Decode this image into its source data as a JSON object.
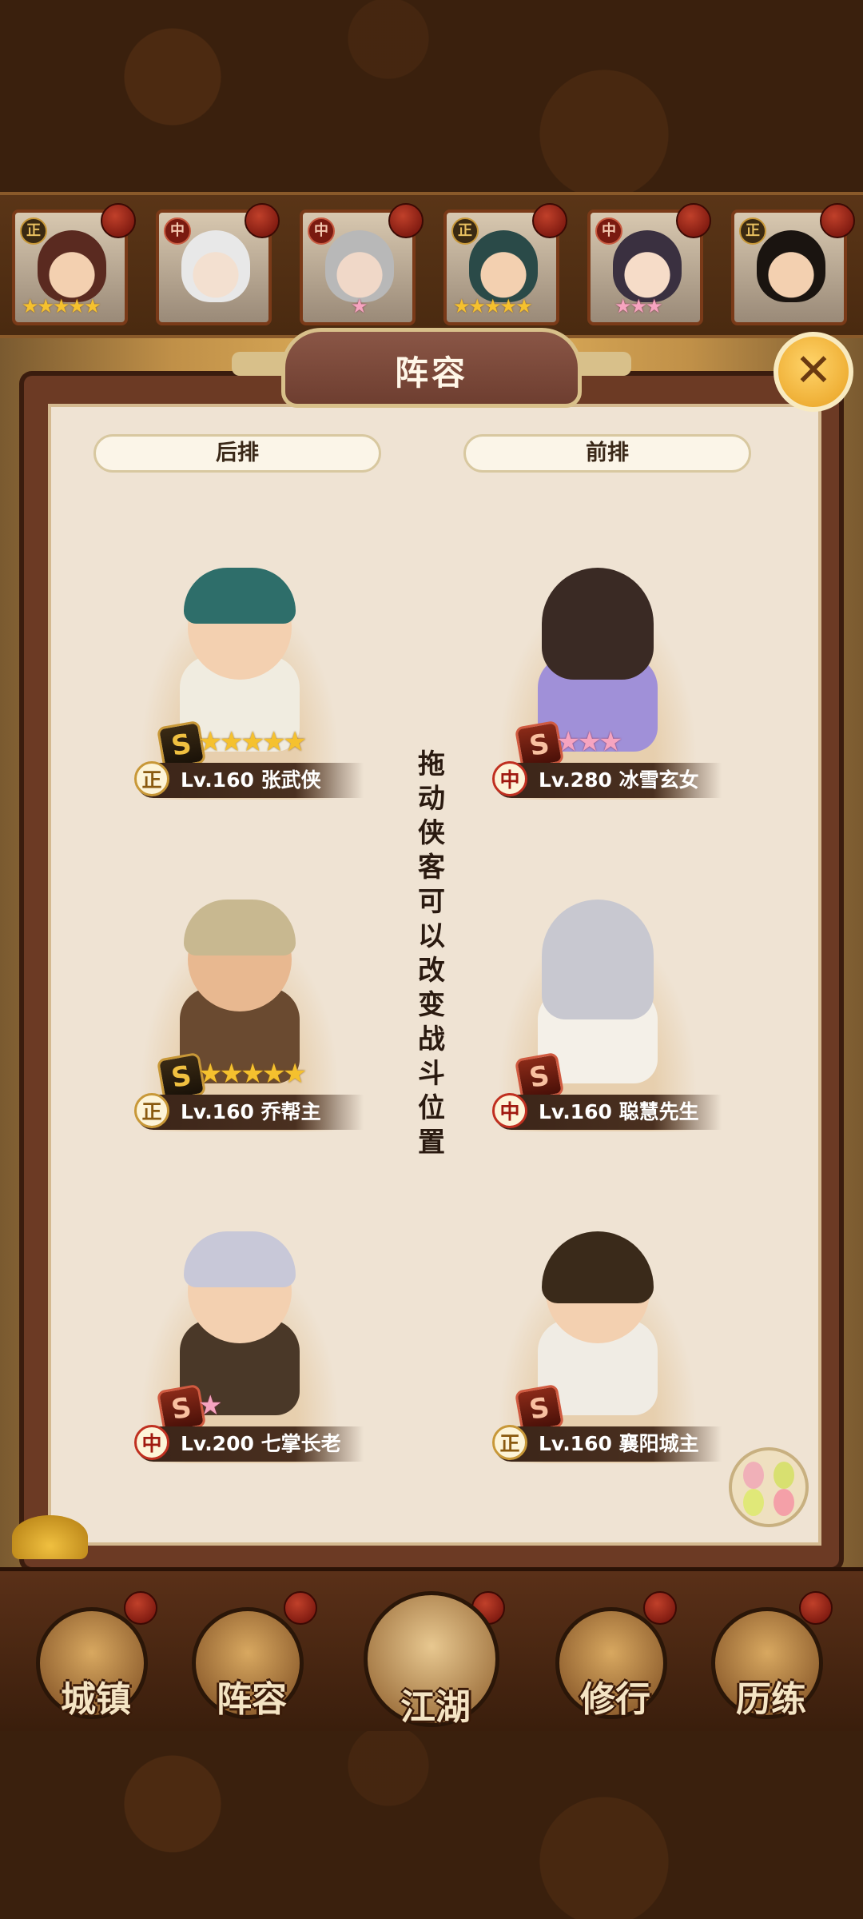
{
  "panel": {
    "title": "阵容",
    "close_icon": "✕"
  },
  "rows": {
    "back": "后排",
    "front": "前排"
  },
  "hint": "拖动侠客可以改变战斗位置",
  "hero_strip": [
    {
      "badge": "正",
      "badge_type": "zheng",
      "stars": "★★★★★",
      "star_color": "gold"
    },
    {
      "badge": "中",
      "badge_type": "zhong",
      "stars": "",
      "star_color": "gold"
    },
    {
      "badge": "中",
      "badge_type": "zhong",
      "stars": "★",
      "star_color": "pink"
    },
    {
      "badge": "正",
      "badge_type": "zheng",
      "stars": "★★★★★",
      "star_color": "gold"
    },
    {
      "badge": "中",
      "badge_type": "zhong",
      "stars": "★★★",
      "star_color": "pink"
    },
    {
      "badge": "正",
      "badge_type": "zheng",
      "stars": "",
      "star_color": "gold"
    }
  ],
  "lineup": [
    {
      "class": "正",
      "level": "Lv.160",
      "name": "张武侠",
      "rank": "S",
      "stars": "★★★★★",
      "star_color": "gold"
    },
    {
      "class": "中",
      "level": "Lv.280",
      "name": "冰雪玄女",
      "rank": "S",
      "stars": "★★★",
      "star_color": "pink"
    },
    {
      "class": "正",
      "level": "Lv.160",
      "name": "乔帮主",
      "rank": "S",
      "stars": "★★★★★",
      "star_color": "gold"
    },
    {
      "class": "中",
      "level": "Lv.160",
      "name": "聪慧先生",
      "rank": "S",
      "stars": "",
      "star_color": "gold"
    },
    {
      "class": "中",
      "level": "Lv.200",
      "name": "七掌长老",
      "rank": "S",
      "stars": "★",
      "star_color": "pink"
    },
    {
      "class": "正",
      "level": "Lv.160",
      "name": "襄阳城主",
      "rank": "S",
      "stars": "",
      "star_color": "gold"
    }
  ],
  "nav": [
    {
      "label": "城镇",
      "icon": "town-icon"
    },
    {
      "label": "阵容",
      "icon": "lineup-icon"
    },
    {
      "label": "江湖",
      "icon": "jianghu-scroll-icon"
    },
    {
      "label": "修行",
      "icon": "training-icon"
    },
    {
      "label": "历练",
      "icon": "trial-icon"
    }
  ]
}
